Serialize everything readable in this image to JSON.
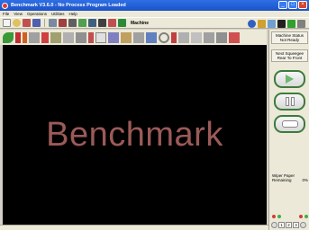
{
  "window": {
    "title": "Benchmark V3.6.0 - No Process Program Loaded",
    "minimize": "_",
    "maximize": "□",
    "close": "×"
  },
  "menu": [
    "File",
    "View",
    "Operations",
    "Utilities",
    "Help"
  ],
  "toolbar": {
    "machine_label": "Machine",
    "icons": [
      "new-icon",
      "open-icon",
      "edit-icon",
      "save-icon",
      "print-icon",
      "camera-icon",
      "printer-icon",
      "folder-icon",
      "book-icon",
      "grid-icon",
      "download-icon"
    ],
    "right_icons": [
      "globe-icon",
      "help-icon",
      "config-icon",
      "network-icon",
      "list-icon",
      "wrench-icon"
    ]
  },
  "tools": [
    "leaf-icon",
    "squeegee-icon",
    "knife-icon",
    "stencil-icon",
    "brush-icon",
    "wiper-icon",
    "board-icon",
    "clamp-icon",
    "fork-icon",
    "doc-icon",
    "lift-icon",
    "scraper-icon",
    "paste-icon",
    "print-head-icon",
    "ring-icon",
    "drill-icon",
    "blade-icon",
    "ruler-icon",
    "rail-icon",
    "arm-icon",
    "paper-icon"
  ],
  "canvas": {
    "brand": "Benchmark"
  },
  "side_panel": {
    "status_title": "Machine Status",
    "status_value": "Not Ready",
    "next_label": "Next Squeegee",
    "next_value": "Rear To Front",
    "wiper_label": "Wiper Paper",
    "wiper_remaining_label": "Remaining",
    "wiper_remaining_value": "0%",
    "pager": [
      "1",
      "2",
      "3"
    ]
  },
  "colors": {
    "titlebar": "#1c52c7",
    "canvas": "#000000",
    "brand_text": "#9a5a58",
    "go_button": "#6fb86f"
  }
}
